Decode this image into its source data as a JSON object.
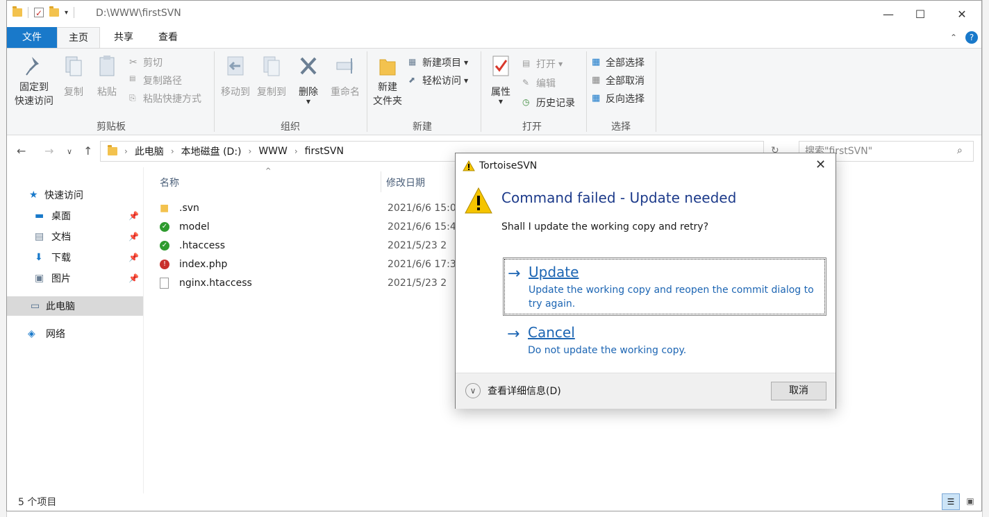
{
  "window": {
    "title": "D:\\WWW\\firstSVN",
    "controls": {
      "minimize": "—",
      "maximize": "☐",
      "close": "✕"
    }
  },
  "ribbon": {
    "tabs": [
      "文件",
      "主页",
      "共享",
      "查看"
    ],
    "groups": {
      "clipboard": {
        "label": "剪贴板",
        "pin": "固定到\n快速访问",
        "copy": "复制",
        "paste": "粘贴",
        "cut": "剪切",
        "copy_path": "复制路径",
        "paste_shortcut": "粘贴快捷方式"
      },
      "organize": {
        "label": "组织",
        "move_to": "移动到",
        "copy_to": "复制到",
        "delete": "删除",
        "rename": "重命名"
      },
      "new": {
        "label": "新建",
        "new_folder": "新建\n文件夹",
        "new_item": "新建项目",
        "easy_access": "轻松访问"
      },
      "open": {
        "label": "打开",
        "properties": "属性",
        "open": "打开",
        "edit": "编辑",
        "history": "历史记录"
      },
      "select": {
        "label": "选择",
        "select_all": "全部选择",
        "select_none": "全部取消",
        "invert": "反向选择"
      }
    }
  },
  "address": {
    "crumbs": [
      "此电脑",
      "本地磁盘 (D:)",
      "WWW",
      "firstSVN"
    ],
    "search_placeholder": "搜索\"firstSVN\""
  },
  "sidebar": {
    "quick_access": "快速访问",
    "items": [
      "桌面",
      "文档",
      "下载",
      "图片"
    ],
    "this_pc": "此电脑",
    "network": "网络"
  },
  "files": {
    "headers": {
      "name": "名称",
      "date": "修改日期"
    },
    "rows": [
      {
        "name": ".svn",
        "date": "2021/6/6 15:0",
        "icon": "folder"
      },
      {
        "name": "model",
        "date": "2021/6/6 15:4",
        "icon": "svn-normal-folder"
      },
      {
        "name": ".htaccess",
        "date": "2021/5/23 2",
        "icon": "svn-normal-file"
      },
      {
        "name": "index.php",
        "date": "2021/6/6 17:3",
        "icon": "svn-conflict-file"
      },
      {
        "name": "nginx.htaccess",
        "date": "2021/5/23 2",
        "icon": "file"
      }
    ]
  },
  "status": {
    "count": "5 个项目"
  },
  "dialog": {
    "title": "TortoiseSVN",
    "main_instruction": "Command failed - Update needed",
    "content": "Shall I update the working copy and retry?",
    "commands": [
      {
        "title": "Update",
        "desc": "Update the working copy and reopen the commit dialog to try again."
      },
      {
        "title": "Cancel",
        "desc": "Do not update the working copy."
      }
    ],
    "details": "查看详细信息(D)",
    "cancel_button": "取消"
  },
  "colors": {
    "accent": "#1979ca",
    "link": "#1c65b3",
    "heading": "#1c3a8a",
    "warning": "#f5c400"
  }
}
